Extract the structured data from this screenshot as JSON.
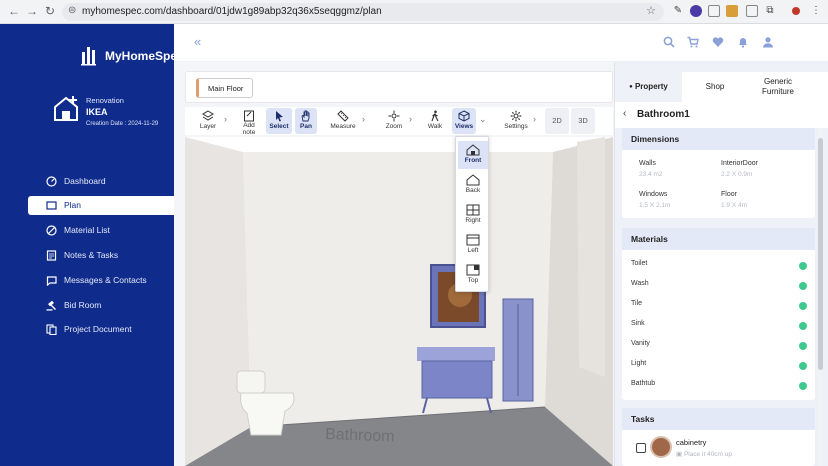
{
  "browser": {
    "url_host": "myhomespec.com",
    "url_path": "/dashboard/01jdw1g89abp32q36x5seqggmz/plan"
  },
  "app": {
    "name": "MyHomeSpec",
    "accent": "#0f2b8c"
  },
  "project": {
    "label": "Renovation",
    "name": "IKEA",
    "date": "Creation Date : 2024-11-29"
  },
  "sidebar": {
    "items": [
      {
        "label": "Dashboard",
        "icon": "dashboard-icon"
      },
      {
        "label": "Plan",
        "icon": "plan-icon",
        "active": true
      },
      {
        "label": "Material List",
        "icon": "material-icon"
      },
      {
        "label": "Notes & Tasks",
        "icon": "notes-icon"
      },
      {
        "label": "Messages & Contacts",
        "icon": "messages-icon"
      },
      {
        "label": "Bid Room",
        "icon": "bid-icon"
      },
      {
        "label": "Project Document",
        "icon": "document-icon"
      }
    ]
  },
  "floor": {
    "tab": "Main Floor"
  },
  "toolbar": {
    "layer": "Layer",
    "add_note": "Add note",
    "select": "Select",
    "pan": "Pan",
    "measure": "Measure",
    "zoom": "Zoom",
    "walk": "Walk",
    "views": "Views",
    "settings": "Settings",
    "mode_2d": "2D",
    "mode_3d": "3D"
  },
  "views_menu": {
    "front": "Front",
    "back": "Back",
    "right": "Right",
    "left": "Left",
    "top": "Top"
  },
  "scene": {
    "floor_label": "Bathroom"
  },
  "panel": {
    "tabs": {
      "property": "Property",
      "shop": "Shop",
      "generic": "Generic Furniture"
    },
    "room": "Bathroom1",
    "dimensions": {
      "title": "Dimensions",
      "walls_label": "Walls",
      "walls_value": "23.4 m2",
      "door_label": "InteriorDoor",
      "door_value": "2.2 X 0.9m",
      "windows_label": "Windows",
      "windows_value": "1.5 X 2.1m",
      "floor_label": "Floor",
      "floor_value": "1.9 X 4m"
    },
    "materials": {
      "title": "Materials",
      "items": [
        "Toilet",
        "Wash",
        "Tile",
        "Sink",
        "Vanity",
        "Light",
        "Bathtub"
      ],
      "status_color": "#3fc98f"
    },
    "tasks": {
      "title": "Tasks",
      "item_title": "cabinetry",
      "item_note": "Place it 40cm up"
    }
  }
}
